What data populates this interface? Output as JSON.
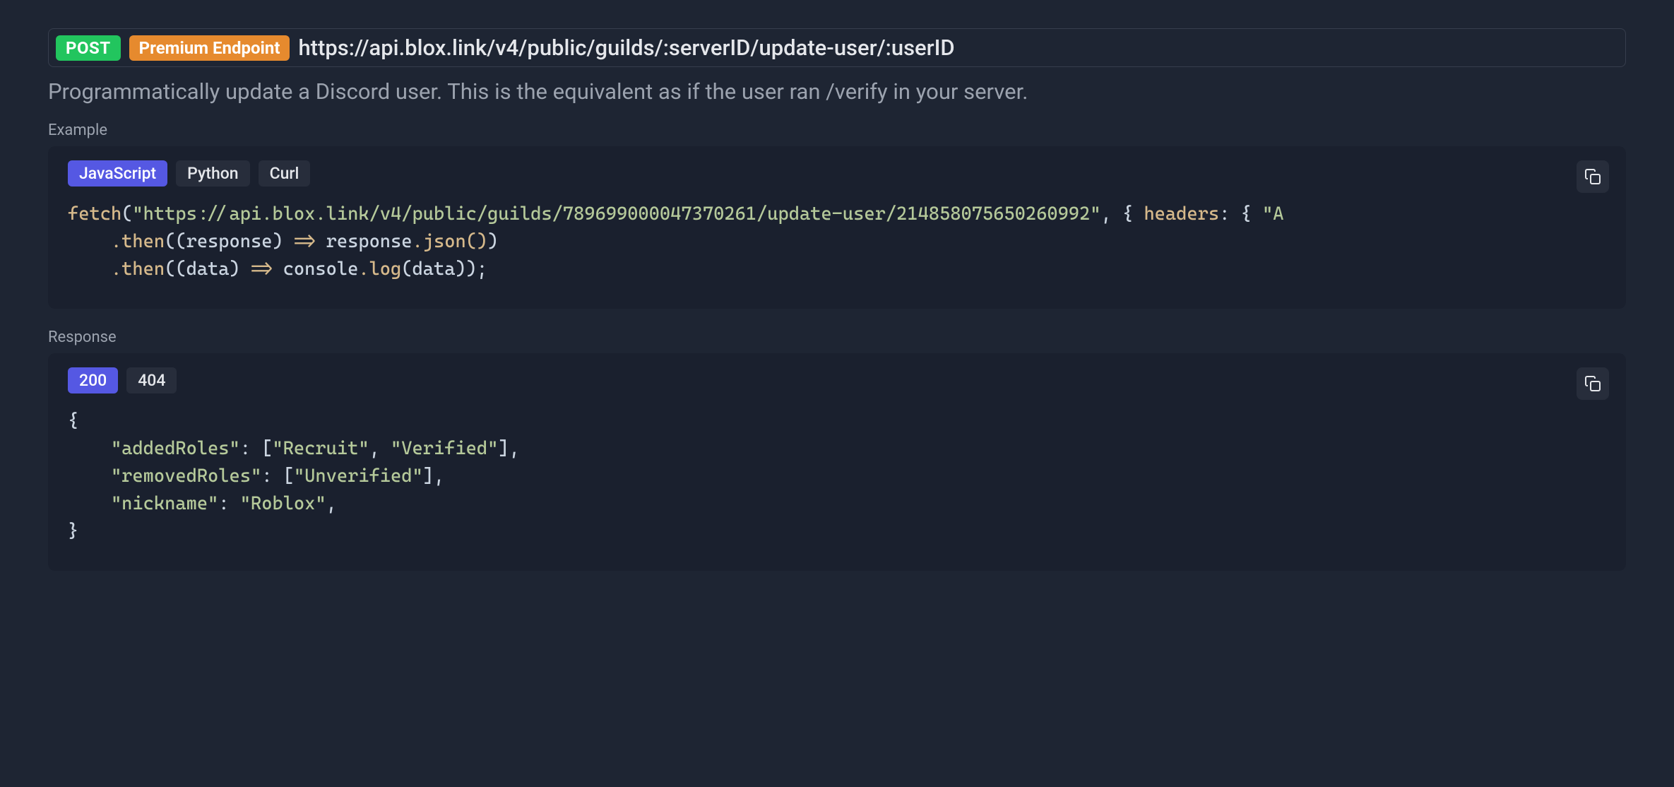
{
  "endpoint": {
    "method": "POST",
    "premium_label": "Premium Endpoint",
    "url": "https://api.blox.link/v4/public/guilds/:serverID/update-user/:userID"
  },
  "description": "Programmatically update a Discord user. This is the equivalent as if the user ran /verify in your server.",
  "example": {
    "label": "Example",
    "tabs": {
      "javascript": "JavaScript",
      "python": "Python",
      "curl": "Curl"
    },
    "code": {
      "fn_fetch": "fetch",
      "url_string": "\"https://api.blox.link/v4/public/guilds/789699000047370261/update-user/214858075650260992\"",
      "headers_key": "headers",
      "auth_fragment": "\"A",
      "then1": ".then",
      "response_param": "response",
      "arrow1": "=>",
      "response_var": "response",
      "json_method": ".json()",
      "then2": ".then",
      "data_param": "data",
      "arrow2": "=>",
      "console": "console",
      "log": ".log",
      "data_var": "data"
    }
  },
  "response": {
    "label": "Response",
    "tabs": {
      "status200": "200",
      "status404": "404"
    },
    "json": {
      "addedRoles_key": "\"addedRoles\"",
      "addedRoles_v1": "\"Recruit\"",
      "addedRoles_v2": "\"Verified\"",
      "removedRoles_key": "\"removedRoles\"",
      "removedRoles_v1": "\"Unverified\"",
      "nickname_key": "\"nickname\"",
      "nickname_v": "\"Roblox\""
    }
  }
}
